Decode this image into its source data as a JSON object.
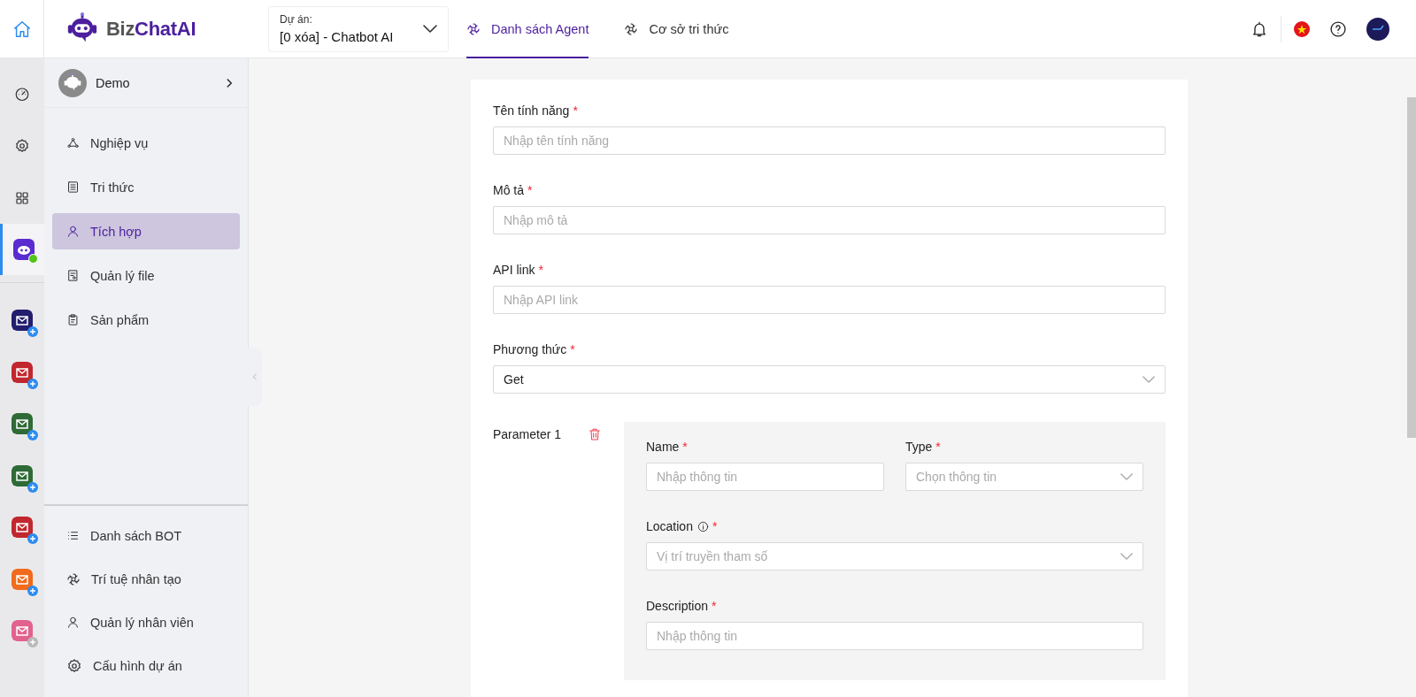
{
  "topbar": {
    "logo": [
      "Biz",
      "ChatAI"
    ],
    "project": {
      "label": "Dự án:",
      "value": "[0 xóa] - Chatbot AI"
    },
    "tabs": [
      {
        "label": "Danh sách Agent",
        "selected": true
      },
      {
        "label": "Cơ sở tri thức",
        "selected": false
      }
    ]
  },
  "rail": {
    "bot": {
      "selected": true,
      "online": true
    },
    "apps": [
      {
        "color": "#231d6e",
        "disabled": false
      },
      {
        "color": "#c1272d",
        "disabled": false
      },
      {
        "color": "#2e6b36",
        "disabled": false
      },
      {
        "color": "#2e6b36",
        "disabled": false
      },
      {
        "color": "#c1272d",
        "disabled": false
      },
      {
        "color": "#f26a1b",
        "disabled": false
      },
      {
        "color": "#e2628e",
        "disabled": true
      }
    ]
  },
  "sidebar": {
    "workspace": "Demo",
    "items": [
      {
        "label": "Nghiệp vụ",
        "selected": false
      },
      {
        "label": "Tri thức",
        "selected": false
      },
      {
        "label": "Tích hợp",
        "selected": true
      },
      {
        "label": "Quản lý file",
        "selected": false
      },
      {
        "label": "Sản phẩm",
        "selected": false
      }
    ],
    "bottom_items": [
      {
        "label": "Danh sách BOT"
      },
      {
        "label": "Trí tuệ nhân tạo"
      },
      {
        "label": "Quản lý nhân viên"
      },
      {
        "label": "Cấu hình dự án"
      }
    ]
  },
  "form": {
    "fields": [
      {
        "label": "Tên tính năng",
        "required_mark": "*",
        "kind": "input",
        "placeholder": "Nhập tên tính năng"
      },
      {
        "label": "Mô tả",
        "required_mark": "*",
        "kind": "input",
        "placeholder": "Nhập mô tả"
      },
      {
        "label": "API link",
        "required_mark": "*",
        "kind": "input",
        "placeholder": "Nhập API link"
      },
      {
        "label": "Phương thức",
        "required_mark": "*",
        "kind": "select",
        "value": "Get"
      }
    ],
    "parameter": {
      "title": "Parameter 1",
      "fields": [
        {
          "label": "Name",
          "required_mark": "*",
          "kind": "input",
          "placeholder": "Nhập thông tin",
          "info": false
        },
        {
          "label": "Type",
          "required_mark": "*",
          "kind": "select",
          "placeholder": "Chọn thông tin",
          "info": false
        },
        {
          "label": "Location",
          "required_mark": "*",
          "kind": "select",
          "placeholder": "Vị trí truyền tham số",
          "info": true
        },
        {
          "label": "Description",
          "required_mark": "*",
          "kind": "input",
          "placeholder": "Nhập thông tin",
          "info": false
        }
      ]
    }
  }
}
